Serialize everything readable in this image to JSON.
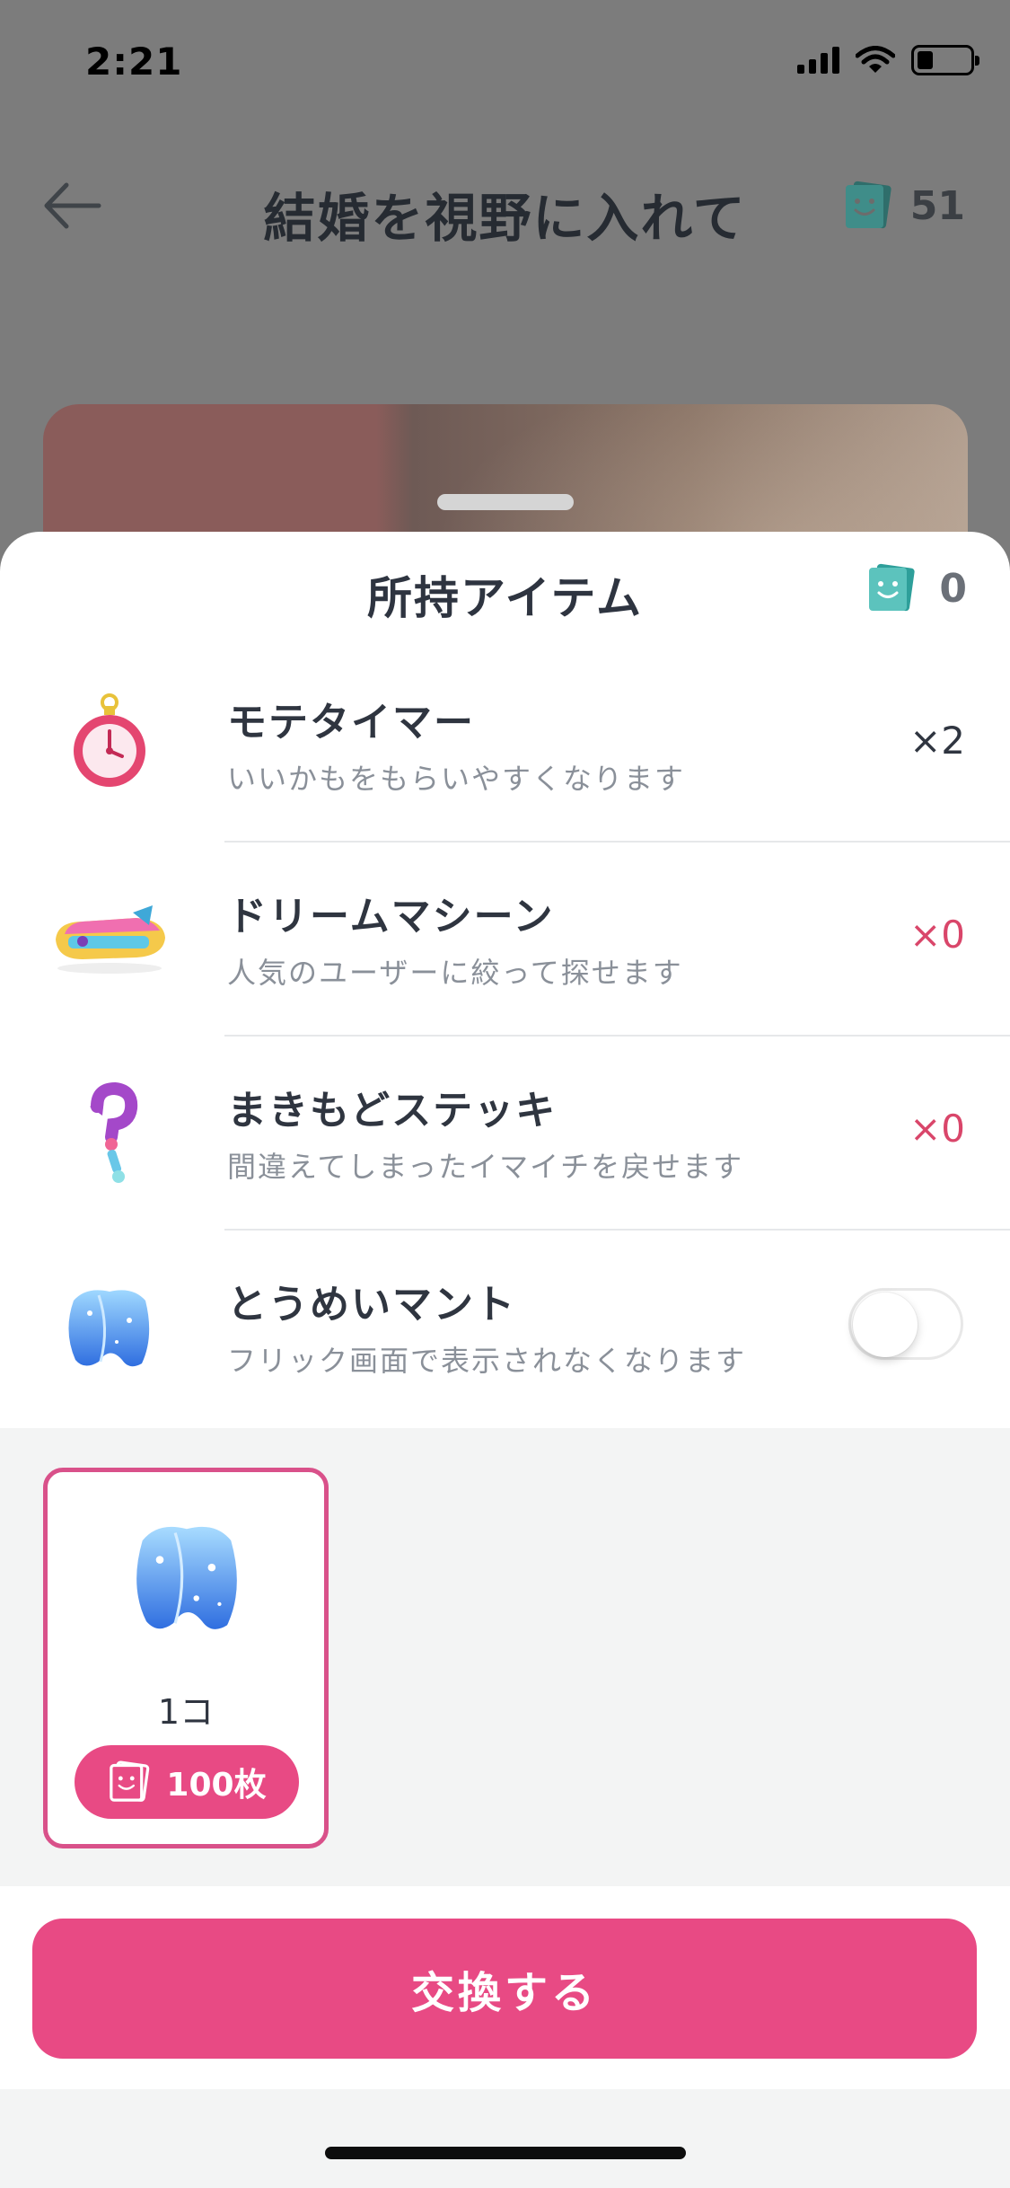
{
  "status_bar": {
    "time": "2:21"
  },
  "nav": {
    "title": "結婚を視野に入れて",
    "ticket_count": "51"
  },
  "sheet": {
    "title": "所持アイテム",
    "ticket_count": "0",
    "items": [
      {
        "name": "モテタイマー",
        "desc": "いいかもをもらいやすくなります",
        "count": "×2",
        "icon": "timer-icon"
      },
      {
        "name": "ドリームマシーン",
        "desc": "人気のユーザーに絞って探せます",
        "count": "×0",
        "icon": "dream-machine-icon"
      },
      {
        "name": "まきもどステッキ",
        "desc": "間違えてしまったイマイチを戻せます",
        "count": "×0",
        "icon": "rewind-stick-icon"
      },
      {
        "name": "とうめいマント",
        "desc": "フリック画面で表示されなくなります",
        "toggle": false,
        "icon": "invisible-cloak-icon"
      }
    ]
  },
  "shop": {
    "quantity": "1コ",
    "price": "100枚",
    "icon": "invisible-cloak-icon"
  },
  "actions": {
    "exchange_label": "交換する"
  },
  "colors": {
    "accent": "#e84a84",
    "ticket": "#4fb4b0",
    "red_count": "#d9466a"
  }
}
